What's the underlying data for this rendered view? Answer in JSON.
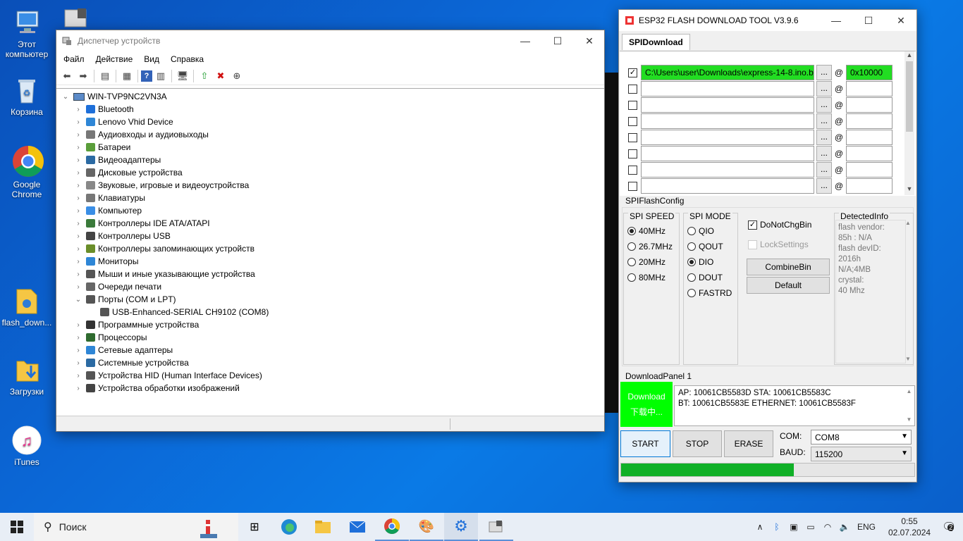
{
  "desktop": {
    "icons": [
      {
        "label": "Этот компьютер"
      },
      {
        "label": "Корзина"
      },
      {
        "label": "Google Chrome"
      },
      {
        "label": "flash_down..."
      },
      {
        "label": "Загрузки"
      },
      {
        "label": "iTunes"
      }
    ]
  },
  "devmgr": {
    "title": "Диспетчер устройств",
    "menu": [
      "Файл",
      "Действие",
      "Вид",
      "Справка"
    ],
    "root": "WIN-TVP9NC2VN3A",
    "categories": [
      {
        "label": "Bluetooth",
        "icon": "bluetooth-icon"
      },
      {
        "label": "Lenovo Vhid Device",
        "icon": "monitor-icon"
      },
      {
        "label": "Аудиовходы и аудиовыходы",
        "icon": "speaker-icon"
      },
      {
        "label": "Батареи",
        "icon": "battery-icon"
      },
      {
        "label": "Видеоадаптеры",
        "icon": "display-adapter-icon"
      },
      {
        "label": "Дисковые устройства",
        "icon": "disk-icon"
      },
      {
        "label": "Звуковые, игровые и видеоустройства",
        "icon": "sound-icon"
      },
      {
        "label": "Клавиатуры",
        "icon": "keyboard-icon"
      },
      {
        "label": "Компьютер",
        "icon": "computer-icon"
      },
      {
        "label": "Контроллеры IDE ATA/ATAPI",
        "icon": "ide-icon"
      },
      {
        "label": "Контроллеры USB",
        "icon": "usb-icon"
      },
      {
        "label": "Контроллеры запоминающих устройств",
        "icon": "storage-icon"
      },
      {
        "label": "Мониторы",
        "icon": "monitor-icon"
      },
      {
        "label": "Мыши и иные указывающие устройства",
        "icon": "mouse-icon"
      },
      {
        "label": "Очереди печати",
        "icon": "printer-icon"
      },
      {
        "label": "Порты (COM и LPT)",
        "icon": "port-icon",
        "expanded": true
      },
      {
        "label": "USB-Enhanced-SERIAL CH9102 (COM8)",
        "icon": "port-icon",
        "child": true
      },
      {
        "label": "Программные устройства",
        "icon": "software-icon"
      },
      {
        "label": "Процессоры",
        "icon": "cpu-icon"
      },
      {
        "label": "Сетевые адаптеры",
        "icon": "network-icon"
      },
      {
        "label": "Системные устройства",
        "icon": "system-icon"
      },
      {
        "label": "Устройства HID (Human Interface Devices)",
        "icon": "hid-icon"
      },
      {
        "label": "Устройства обработки изображений",
        "icon": "camera-icon"
      }
    ]
  },
  "esp": {
    "title": "ESP32 FLASH DOWNLOAD TOOL V3.9.6",
    "tab": "SPIDownload",
    "files": [
      {
        "checked": true,
        "path": "C:\\Users\\user\\Downloads\\express-14-8.ino.b",
        "addr": "0x10000"
      },
      {
        "checked": false,
        "path": "",
        "addr": ""
      },
      {
        "checked": false,
        "path": "",
        "addr": ""
      },
      {
        "checked": false,
        "path": "",
        "addr": ""
      },
      {
        "checked": false,
        "path": "",
        "addr": ""
      },
      {
        "checked": false,
        "path": "",
        "addr": ""
      },
      {
        "checked": false,
        "path": "",
        "addr": ""
      },
      {
        "checked": false,
        "path": "",
        "addr": ""
      }
    ],
    "browse_label": "...",
    "at_label": "@",
    "spi_flash_config": "SPIFlashConfig",
    "spi_speed": {
      "title": "SPI SPEED",
      "options": [
        "40MHz",
        "26.7MHz",
        "20MHz",
        "80MHz"
      ],
      "selected": "40MHz"
    },
    "spi_mode": {
      "title": "SPI MODE",
      "options": [
        "QIO",
        "QOUT",
        "DIO",
        "DOUT",
        "FASTRD"
      ],
      "selected": "DIO"
    },
    "do_not_chg_bin": "DoNotChgBin",
    "lock_settings": "LockSettings",
    "combine_bin": "CombineBin",
    "default_btn": "Default",
    "detected_info": {
      "title": "DetectedInfo",
      "lines": [
        "flash vendor:",
        "85h : N/A",
        "flash devID:",
        "2016h",
        "N/A;4MB",
        "crystal:",
        "40 Mhz"
      ]
    },
    "download_panel": "DownloadPanel 1",
    "status_box": {
      "line1": "Download",
      "line2": "下载中...",
      "color": "#00ff00"
    },
    "log": [
      "AP:  10061CB5583D  STA:  10061CB5583C",
      "BT:  10061CB5583E  ETHERNET:  10061CB5583F"
    ],
    "start": "START",
    "stop": "STOP",
    "erase": "ERASE",
    "com_label": "COM:",
    "com_value": "COM8",
    "baud_label": "BAUD:",
    "baud_value": "115200",
    "progress": 0.59,
    "progress_color": "#10b027"
  },
  "taskbar": {
    "search_placeholder": "Поиск",
    "lang": "ENG",
    "time": "0:55",
    "date": "02.07.2024",
    "notifications": "2"
  }
}
